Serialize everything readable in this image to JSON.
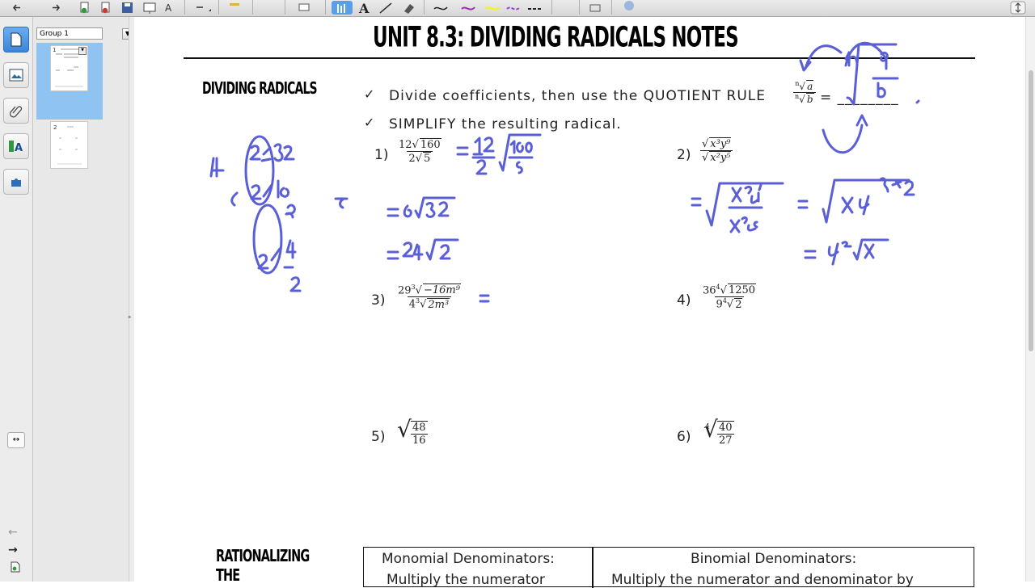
{
  "toolbar": {
    "icons": [
      "arrow-left-icon",
      "arrow-right-icon",
      "add-page-icon",
      "delete-page-icon",
      "save-icon",
      "screen-shade-icon",
      "table-icon",
      "select-icon",
      "pen-icon",
      "text-icon",
      "line-icon",
      "eraser-icon",
      "line-style-icon",
      "pen-color-icon",
      "highlighter-icon",
      "creative-pen-icon",
      "dashed-line-icon",
      "fill-icon",
      "properties-icon",
      "collapse-icon"
    ]
  },
  "sidebar": {
    "tools": [
      "page-sorter-icon",
      "gallery-icon",
      "attachments-icon",
      "properties-icon",
      "addons-icon"
    ]
  },
  "thumbnails": {
    "group_label": "Group 1",
    "pages": [
      {
        "number": "1"
      },
      {
        "number": "2"
      }
    ]
  },
  "page": {
    "title": "UNIT 8.3: DIVIDING RADICALS NOTES",
    "section_dividing": "DIVIDING RADICALS",
    "bullets": [
      "Divide coefficients, then use the QUOTIENT RULE",
      "SIMPLIFY the resulting radical."
    ],
    "quotient_rule_tail": "= ________",
    "problems": [
      {
        "label": "1)",
        "num_coef": "12",
        "num_rad": "160",
        "den_coef": "2",
        "den_rad": "5"
      },
      {
        "label": "2)",
        "num_rad": "x³y⁹",
        "den_rad": "x²y⁵"
      },
      {
        "label": "3)",
        "num_coef": "29",
        "num_index": "3",
        "num_rad": "−16m⁹",
        "den_coef": "4",
        "den_index": "3",
        "den_rad": "2m³"
      },
      {
        "label": "4)",
        "num_coef": "36",
        "num_index": "4",
        "num_rad": "1250",
        "den_coef": "9",
        "den_index": "4",
        "den_rad": "2"
      },
      {
        "label": "5)",
        "num": "48",
        "den": "16"
      },
      {
        "label": "6)",
        "index": "4",
        "num": "40",
        "den": "27"
      }
    ],
    "section_rationalizing": "RATIONALIZING THE",
    "table": {
      "col1_header": "Monomial Denominators:",
      "col1_sub": "Multiply the numerator",
      "col2_header": "Binomial Denominators:",
      "col2_sub": "Multiply the numerator and denominator by"
    }
  },
  "annotations": {
    "ink_color": "#5b5fd6",
    "problem1_work": [
      "= 12/2 √(160/5)",
      "= 6√32",
      "= 24√2"
    ],
    "factor_tree": [
      "2",
      "32",
      "2",
      "16",
      "2",
      "8",
      "2",
      "4",
      "2",
      "4"
    ],
    "problem2_work": [
      "= √(x³y⁹ / x²y⁵)",
      "= √(xy⁴÷2)",
      "= y²√x"
    ],
    "problem3_work": "=",
    "quotient_sketch": "n√(a/b)"
  }
}
